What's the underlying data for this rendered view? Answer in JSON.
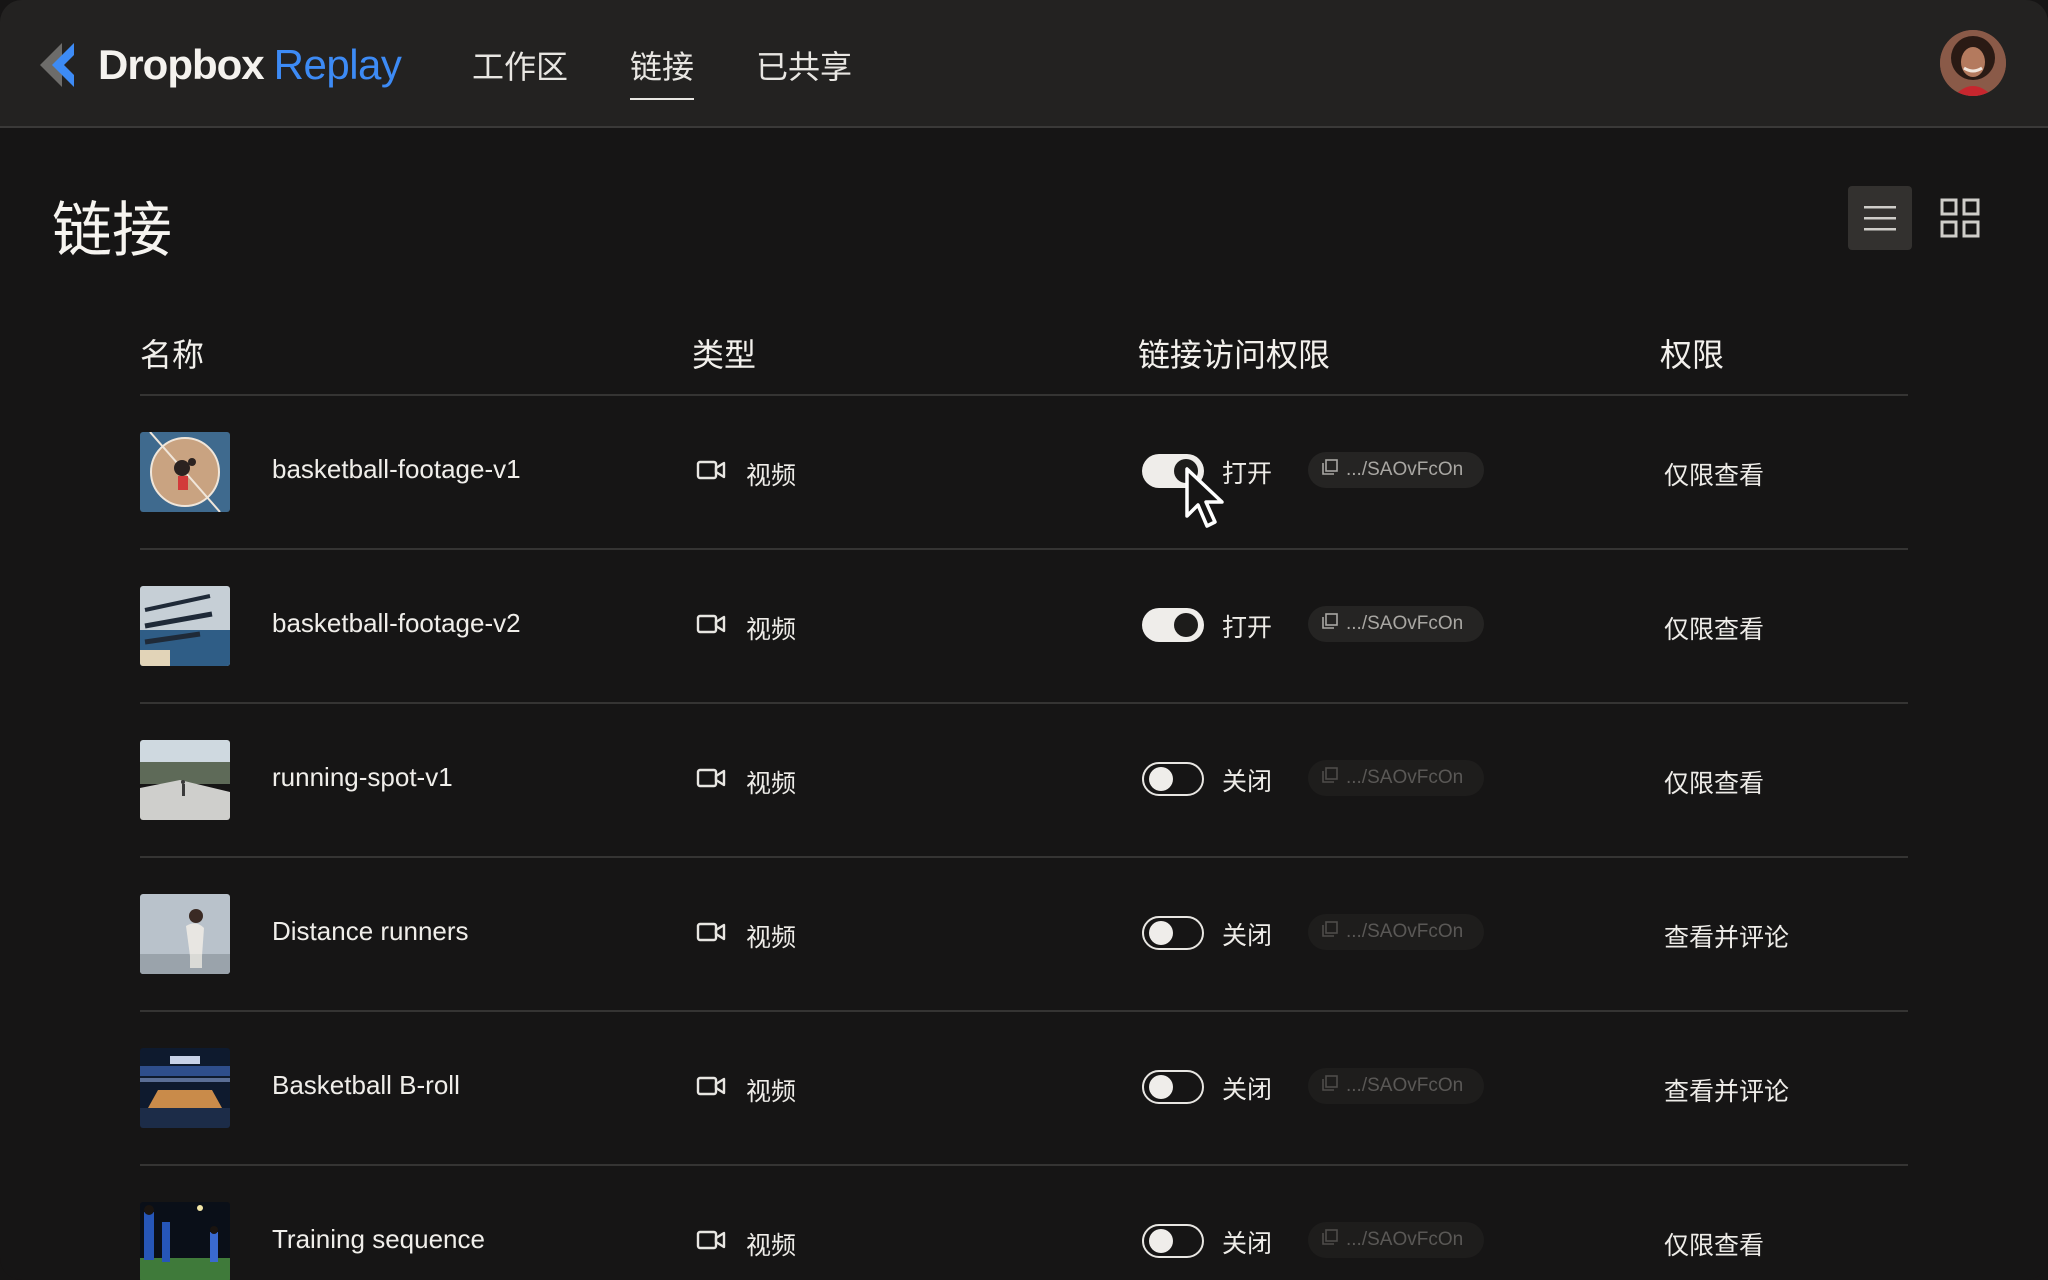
{
  "brand": {
    "word1": "Dropbox",
    "word2": "Replay"
  },
  "nav": [
    {
      "label": "工作区",
      "active": false
    },
    {
      "label": "链接",
      "active": true
    },
    {
      "label": "已共享",
      "active": false
    }
  ],
  "page": {
    "title": "链接"
  },
  "table": {
    "headers": {
      "name": "名称",
      "type": "类型",
      "access": "链接访问权限",
      "permission": "权限"
    },
    "rows": [
      {
        "name": "basketball-footage-v1",
        "type": "视频",
        "toggle_state": "on",
        "toggle_label": "打开",
        "link": ".../SAOvFcOn",
        "permission": "仅限查看",
        "thumb": "court-top"
      },
      {
        "name": "basketball-footage-v2",
        "type": "视频",
        "toggle_state": "on",
        "toggle_label": "打开",
        "link": ".../SAOvFcOn",
        "permission": "仅限查看",
        "thumb": "court-shadow"
      },
      {
        "name": "running-spot-v1",
        "type": "视频",
        "toggle_state": "off",
        "toggle_label": "关闭",
        "link": ".../SAOvFcOn",
        "permission": "仅限查看",
        "thumb": "road-runner"
      },
      {
        "name": "Distance runners",
        "type": "视频",
        "toggle_state": "off",
        "toggle_label": "关闭",
        "link": ".../SAOvFcOn",
        "permission": "查看并评论",
        "thumb": "runner-sky"
      },
      {
        "name": "Basketball B-roll",
        "type": "视频",
        "toggle_state": "off",
        "toggle_label": "关闭",
        "link": ".../SAOvFcOn",
        "permission": "查看并评论",
        "thumb": "arena"
      },
      {
        "name": "Training sequence",
        "type": "视频",
        "toggle_state": "off",
        "toggle_label": "关闭",
        "link": ".../SAOvFcOn",
        "permission": "仅限查看",
        "thumb": "field"
      }
    ]
  },
  "colors": {
    "accent": "#3d8bf5",
    "background": "#161515",
    "topbar": "#232221"
  },
  "icons": {
    "view_list": "list-icon",
    "view_grid": "grid-icon",
    "type": "video-camera-icon",
    "copy": "copy-icon"
  }
}
